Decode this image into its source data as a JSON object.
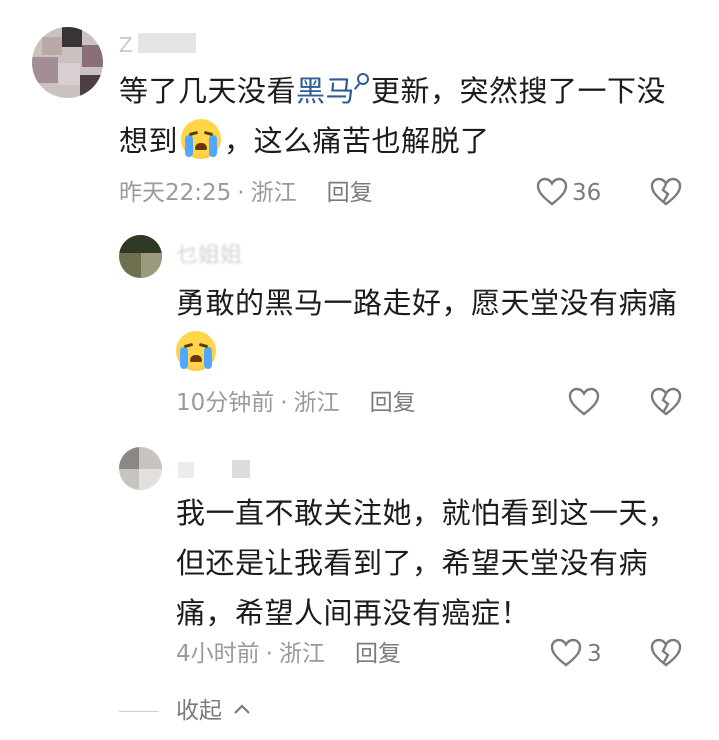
{
  "comments": [
    {
      "username_fragment": "Z",
      "text_parts": [
        "等了几天没看",
        "黑马",
        "更新，突然搜了一下没想到",
        "，这么痛苦也解脱了"
      ],
      "time": "昨天22:25",
      "location": "浙江",
      "reply_label": "回复",
      "likes": "36",
      "icons": {
        "like": "heart-icon",
        "dislike": "broken-heart-icon",
        "emoji": "loudly-crying-face-emoji",
        "search": "search-icon"
      }
    },
    {
      "username_fragment": "乜姐姐",
      "text_parts": [
        "勇敢的黑马一路走好，愿天堂没有病痛"
      ],
      "time": "10分钟前",
      "location": "浙江",
      "reply_label": "回复",
      "likes": ""
    },
    {
      "username_fragment": "",
      "text_parts": [
        "我一直不敢关注她，就怕看到这一天，但还是让我看到了，希望天堂没有病痛，希望人间再没有癌症！"
      ],
      "time": "4小时前",
      "location": "浙江",
      "reply_label": "回复",
      "likes": "3"
    }
  ],
  "separator": "·",
  "collapse_label": "收起",
  "colors": {
    "link": "#2d5c96",
    "meta": "#9a9a9a",
    "icon": "#7b7b7b"
  }
}
